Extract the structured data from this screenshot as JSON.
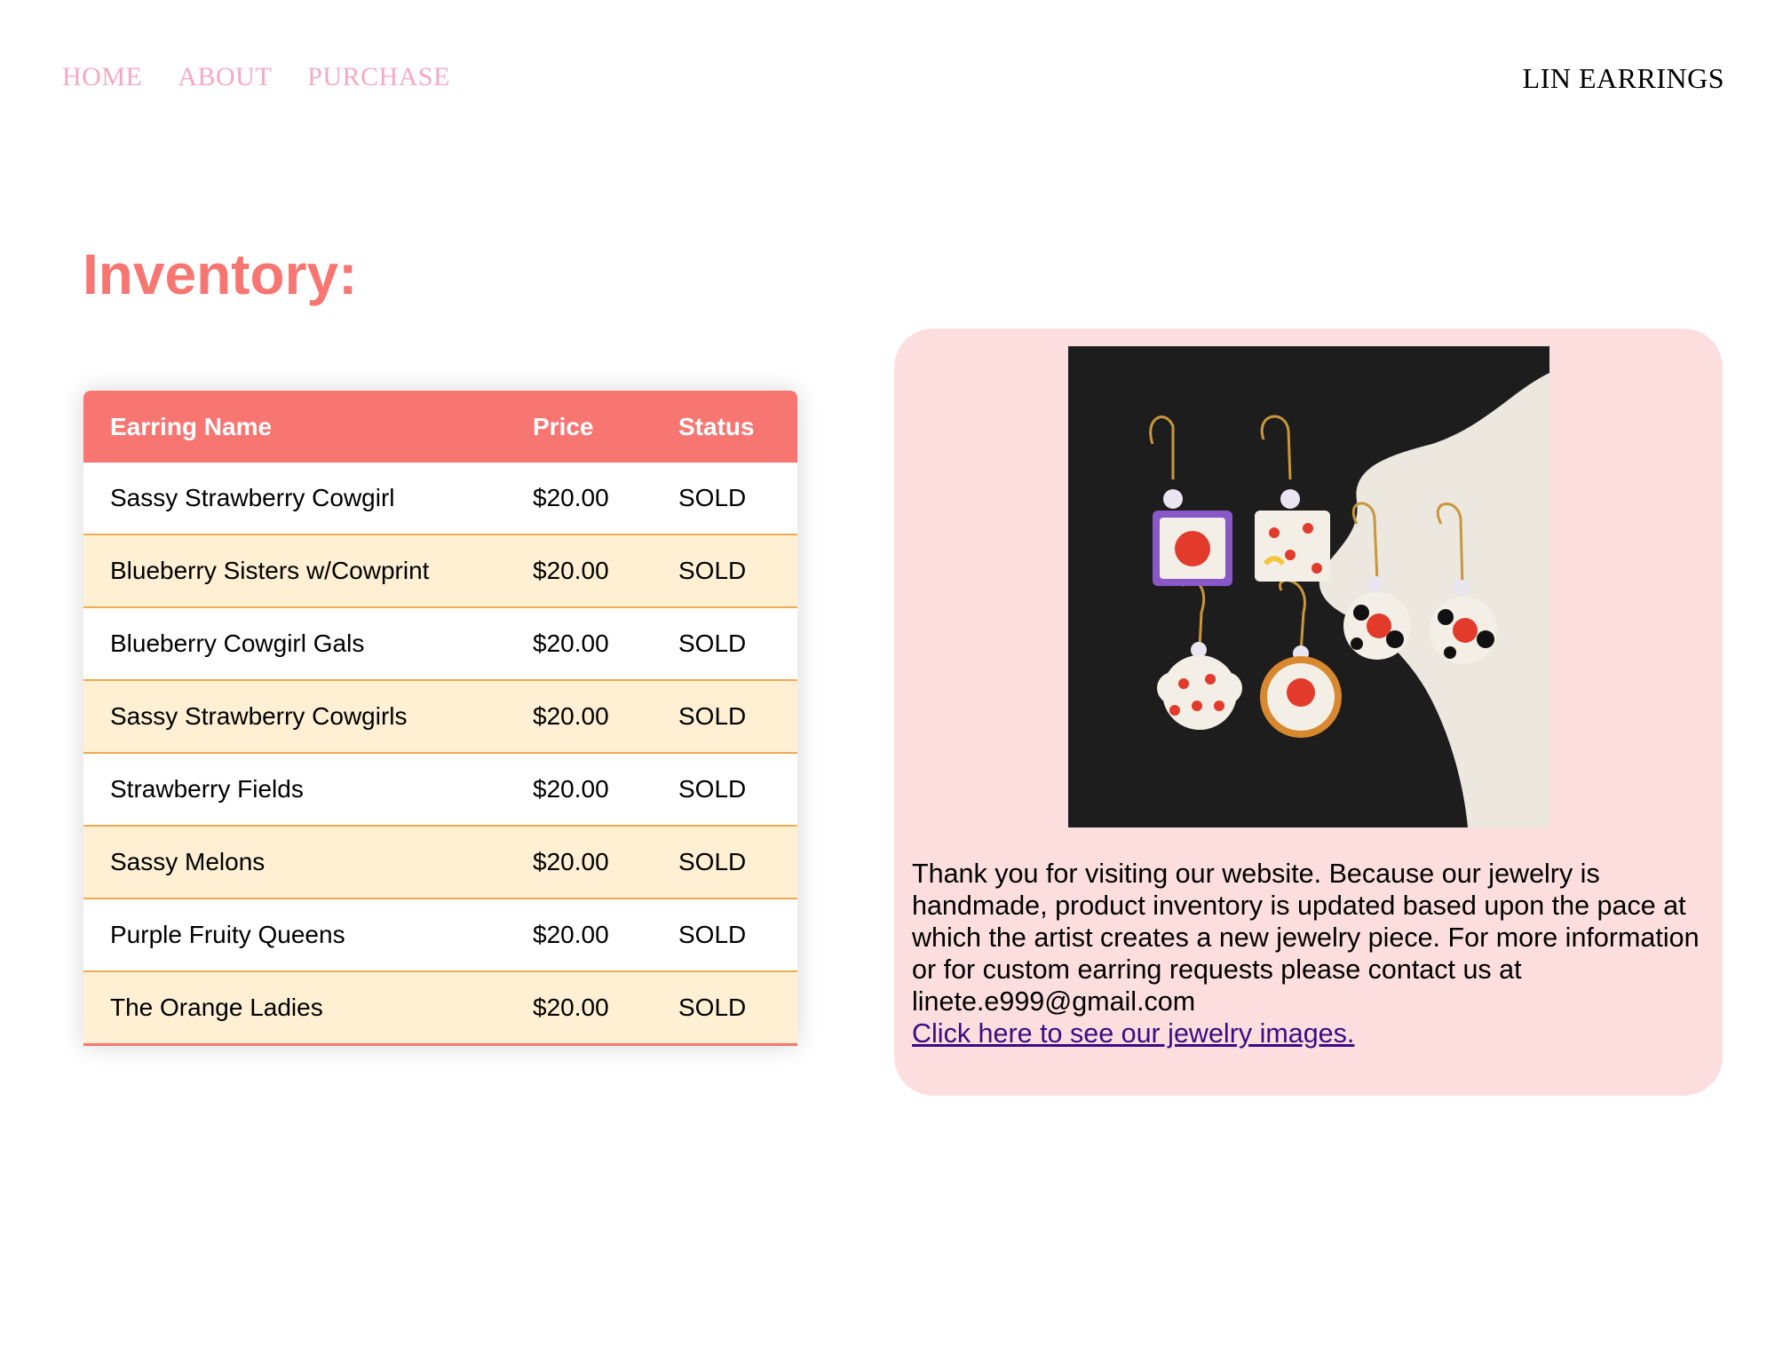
{
  "nav": {
    "items": [
      {
        "label": "HOME"
      },
      {
        "label": "ABOUT"
      },
      {
        "label": "PURCHASE"
      }
    ],
    "brand": "LIN EARRINGS"
  },
  "page": {
    "title": "Inventory:"
  },
  "inventory": {
    "headers": {
      "name": "Earring Name",
      "price": "Price",
      "status": "Status"
    },
    "rows": [
      {
        "name": "Sassy Strawberry Cowgirl",
        "price": "$20.00",
        "status": "SOLD"
      },
      {
        "name": "Blueberry Sisters w/Cowprint",
        "price": "$20.00",
        "status": "SOLD"
      },
      {
        "name": "Blueberry Cowgirl Gals",
        "price": "$20.00",
        "status": "SOLD"
      },
      {
        "name": "Sassy Strawberry Cowgirls",
        "price": "$20.00",
        "status": "SOLD"
      },
      {
        "name": "Strawberry Fields",
        "price": "$20.00",
        "status": "SOLD"
      },
      {
        "name": "Sassy Melons",
        "price": "$20.00",
        "status": "SOLD"
      },
      {
        "name": "Purple Fruity Queens",
        "price": "$20.00",
        "status": "SOLD"
      },
      {
        "name": "The Orange Ladies",
        "price": "$20.00",
        "status": "SOLD"
      }
    ]
  },
  "info": {
    "text": "Thank you for visiting our website. Because our jewelry is handmade, product inventory is updated based upon the pace at which the artist creates a new jewelry piece. For more information or for custom earring requests please contact us at linete.e999@gmail.com",
    "link_label": "Click here to see our jewelry images."
  },
  "colors": {
    "accent": "#f87672",
    "nav_link": "#f5a9c0",
    "row_alt": "#fff0d4",
    "row_border": "#efab4f",
    "card_bg": "#fddede",
    "link": "#3b0b85"
  }
}
